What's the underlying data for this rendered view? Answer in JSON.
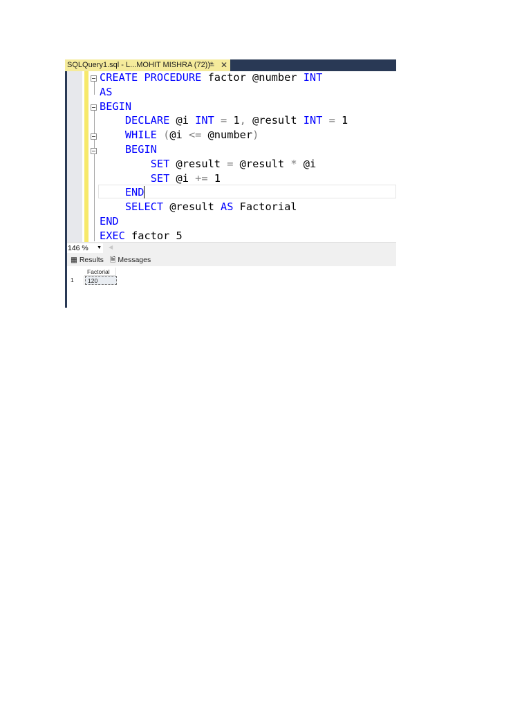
{
  "window": {
    "tab_title": "SQLQuery1.sql - L...MOHIT MISHRA (72))*",
    "pin_icon": "pin-icon",
    "close_icon": "close-icon"
  },
  "editor": {
    "lines": [
      [
        {
          "t": "CREATE PROCEDURE",
          "c": "kw"
        },
        {
          "t": " factor @number ",
          "c": ""
        },
        {
          "t": "INT",
          "c": "kw"
        }
      ],
      [
        {
          "t": "AS",
          "c": "kw"
        }
      ],
      [
        {
          "t": "BEGIN",
          "c": "kw"
        }
      ],
      [
        {
          "t": "    ",
          "c": ""
        },
        {
          "t": "DECLARE",
          "c": "kw"
        },
        {
          "t": " @i ",
          "c": ""
        },
        {
          "t": "INT",
          "c": "kw"
        },
        {
          "t": " = ",
          "c": "op"
        },
        {
          "t": "1",
          "c": ""
        },
        {
          "t": ", ",
          "c": "op"
        },
        {
          "t": "@result ",
          "c": ""
        },
        {
          "t": "INT",
          "c": "kw"
        },
        {
          "t": " = ",
          "c": "op"
        },
        {
          "t": "1",
          "c": ""
        }
      ],
      [
        {
          "t": "    ",
          "c": ""
        },
        {
          "t": "WHILE",
          "c": "kw"
        },
        {
          "t": " (",
          "c": "op"
        },
        {
          "t": "@i ",
          "c": ""
        },
        {
          "t": "<=",
          "c": "op"
        },
        {
          "t": " @number",
          "c": ""
        },
        {
          "t": ")",
          "c": "op"
        }
      ],
      [
        {
          "t": "    ",
          "c": ""
        },
        {
          "t": "BEGIN",
          "c": "kw"
        }
      ],
      [
        {
          "t": "        ",
          "c": ""
        },
        {
          "t": "SET",
          "c": "kw"
        },
        {
          "t": " @result ",
          "c": ""
        },
        {
          "t": "=",
          "c": "op"
        },
        {
          "t": " @result ",
          "c": ""
        },
        {
          "t": "*",
          "c": "op"
        },
        {
          "t": " @i",
          "c": ""
        }
      ],
      [
        {
          "t": "        ",
          "c": ""
        },
        {
          "t": "SET",
          "c": "kw"
        },
        {
          "t": " @i ",
          "c": ""
        },
        {
          "t": "+=",
          "c": "op"
        },
        {
          "t": " 1",
          "c": ""
        }
      ],
      [
        {
          "t": "    ",
          "c": ""
        },
        {
          "t": "END",
          "c": "kw"
        }
      ],
      [
        {
          "t": "    ",
          "c": ""
        },
        {
          "t": "SELECT",
          "c": "kw"
        },
        {
          "t": " @result ",
          "c": ""
        },
        {
          "t": "AS",
          "c": "kw"
        },
        {
          "t": " Factorial",
          "c": ""
        }
      ],
      [
        {
          "t": "END",
          "c": "kw"
        }
      ],
      [
        {
          "t": "EXEC",
          "c": "kw"
        },
        {
          "t": " factor 5",
          "c": ""
        }
      ]
    ]
  },
  "zoom": {
    "value": "146 %"
  },
  "results": {
    "tabs": [
      {
        "label": "Results",
        "icon": "grid-icon"
      },
      {
        "label": "Messages",
        "icon": "messages-icon"
      }
    ],
    "columns": [
      "Factorial"
    ],
    "rows": [
      {
        "num": "1",
        "values": [
          "120"
        ]
      }
    ]
  },
  "colors": {
    "keyword": "#0000ff",
    "operator": "#808080",
    "tab": "#f5eb9b",
    "chrome": "#293955"
  }
}
